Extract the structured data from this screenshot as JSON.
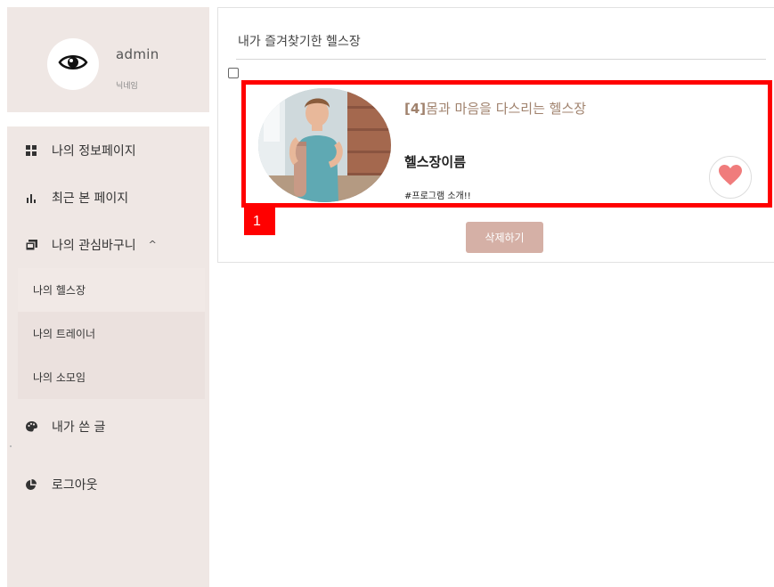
{
  "profile": {
    "name": "admin",
    "nickname": "닉네임"
  },
  "menu": {
    "items": [
      {
        "label": "나의 정보페이지",
        "icon": "grid-icon"
      },
      {
        "label": "최근 본 페이지",
        "icon": "bar-chart-icon"
      },
      {
        "label": "나의 관심바구니",
        "icon": "images-icon",
        "chevron": "^"
      },
      {
        "label": "내가 쓴 글",
        "icon": "palette-icon"
      },
      {
        "label": "로그아웃",
        "icon": "pie-chart-icon"
      }
    ],
    "submenu": [
      "나의 헬스장",
      "나의 트레이너",
      "나의 소모임"
    ]
  },
  "main": {
    "title": "내가 즐겨찾기한 헬스장",
    "card": {
      "number": "[4]",
      "title": "몸과 마음을 다스리는 헬스장",
      "name": "헬스장이름",
      "tag": "#프로그램 소개!!",
      "favorited": true
    },
    "badge": "1",
    "delete_label": "삭제하기"
  },
  "colors": {
    "sidebar_bg": "#efe7e4",
    "accent": "#d5b0a6",
    "title_brown": "#a0826d",
    "heart": "#f07c7c",
    "highlight": "#ff0000"
  }
}
